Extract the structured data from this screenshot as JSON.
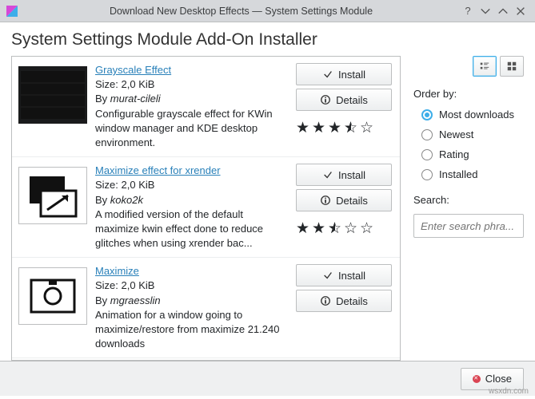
{
  "titlebar": {
    "title": "Download New Desktop Effects — System Settings Module"
  },
  "page_title": "System Settings Module Add-On Installer",
  "buttons": {
    "install": "Install",
    "details": "Details",
    "close": "Close"
  },
  "side": {
    "order_label": "Order by:",
    "options": {
      "most": "Most downloads",
      "newest": "Newest",
      "rating": "Rating",
      "installed": "Installed"
    },
    "search_label": "Search:",
    "search_placeholder": "Enter search phra..."
  },
  "items": [
    {
      "name": "Grayscale Effect",
      "size": "Size: 2,0 KiB",
      "by_label": "By ",
      "author": "murat-cileli",
      "desc": "Configurable grayscale effect for KWin window manager and KDE desktop environment.",
      "stars_full": 3,
      "stars_half": 1,
      "stars_empty": 1
    },
    {
      "name": "Maximize effect for xrender",
      "size": "Size: 2,0 KiB",
      "by_label": "By ",
      "author": "koko2k",
      "desc": "A modified version of the default maximize kwin effect done to reduce glitches when using xrender bac...",
      "stars_full": 2,
      "stars_half": 1,
      "stars_empty": 2
    },
    {
      "name": "Maximize",
      "size": "Size: 2,0 KiB",
      "by_label": "By ",
      "author": "mgraesslin",
      "desc": "Animation for a window going to maximize/restore from maximize 21.240 downloads",
      "stars_full": 0,
      "stars_half": 0,
      "stars_empty": 0
    }
  ],
  "watermark": "wsxdn.com"
}
